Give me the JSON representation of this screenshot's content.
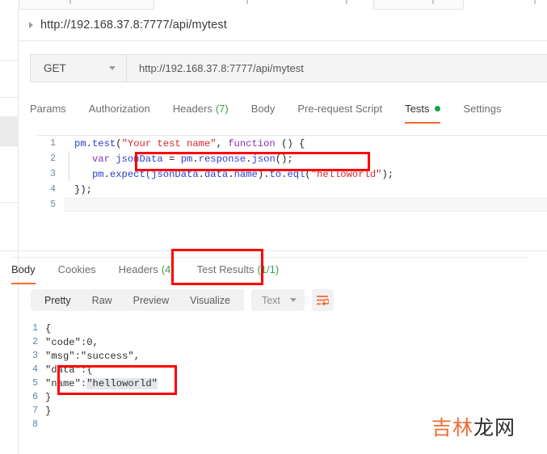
{
  "window": {
    "request_title": "http://192.168.37.8:7777/api/mytest",
    "collapse_icon": "caret-right-icon"
  },
  "url_bar": {
    "method": "GET",
    "method_dropdown_icon": "chevron-down-icon",
    "url": "http://192.168.37.8:7777/api/mytest"
  },
  "request_tabs": [
    {
      "label": "Params",
      "count": "",
      "active": false,
      "dot": false
    },
    {
      "label": "Authorization",
      "count": "",
      "active": false,
      "dot": false
    },
    {
      "label": "Headers",
      "count": "(7)",
      "active": false,
      "dot": false
    },
    {
      "label": "Body",
      "count": "",
      "active": false,
      "dot": false
    },
    {
      "label": "Pre-request Script",
      "count": "",
      "active": false,
      "dot": false
    },
    {
      "label": "Tests",
      "count": "",
      "active": true,
      "dot": true
    },
    {
      "label": "Settings",
      "count": "",
      "active": false,
      "dot": false
    }
  ],
  "script_editor": {
    "lines": [
      {
        "no": "1",
        "guide": false
      },
      {
        "no": "2",
        "guide": true
      },
      {
        "no": "3",
        "guide": true
      },
      {
        "no": "4",
        "guide": false
      },
      {
        "no": "5",
        "guide": false
      }
    ],
    "line1": {
      "a": "pm",
      "b": ".",
      "c": "test",
      "d": "(",
      "e": "\"Your test name\"",
      "f": ", ",
      "g": "function",
      "h": " () {"
    },
    "line2": {
      "a": "var",
      "b": " jsonData ",
      "c": "=",
      "d": " pm",
      "e": ".",
      "f": "response",
      "g": ".",
      "h": "json",
      "i": "();"
    },
    "line3": {
      "a": "pm",
      "b": ".",
      "c": "expect",
      "d": "(jsonData",
      "e": ".",
      "f": "data",
      "g": ".",
      "h": "name",
      "i": ").",
      "j": "to",
      "k": ".",
      "l": "eql",
      "m": "(",
      "n": "\"helloworld\"",
      "o": ");"
    },
    "line4": {
      "a": "});"
    }
  },
  "response_tabs": [
    {
      "label": "Body",
      "count": "",
      "active": true
    },
    {
      "label": "Cookies",
      "count": "",
      "active": false
    },
    {
      "label": "Headers",
      "count": "(4)",
      "active": false
    },
    {
      "label": "Test Results",
      "count": "(1/1)",
      "active": false
    }
  ],
  "format_bar": {
    "options": [
      "Pretty",
      "Raw",
      "Preview",
      "Visualize"
    ],
    "active_option": "Pretty",
    "type_label": "Text",
    "type_dropdown_icon": "chevron-down-icon",
    "wrap_icon": "word-wrap-icon"
  },
  "response_body": {
    "lines": [
      {
        "no": "1",
        "text": "{",
        "highlight": ""
      },
      {
        "no": "2",
        "text": "\"code\":0,",
        "highlight": ""
      },
      {
        "no": "3",
        "text": "\"msg\":\"success\",",
        "highlight": ""
      },
      {
        "no": "4",
        "text": "\"data\":{",
        "highlight": ""
      },
      {
        "no": "5",
        "text": "\"name\":",
        "highlight": "\"helloworld\""
      },
      {
        "no": "6",
        "text": "}",
        "highlight": ""
      },
      {
        "no": "7",
        "text": "}",
        "highlight": ""
      },
      {
        "no": "8",
        "text": "",
        "highlight": ""
      }
    ]
  },
  "annotations": {
    "box_script_assertion": "red-highlight-box",
    "box_test_results_tab": "red-highlight-box",
    "box_response_data": "red-highlight-box"
  },
  "watermark": {
    "orange_part": "吉林",
    "dark_part": "龙网"
  },
  "colors": {
    "accent_orange": "#ef6c33",
    "count_green": "#37a04a",
    "annotation_red": "#fe0000",
    "code_string": "#d6262b",
    "code_identifier": "#2b3dcf",
    "code_keyword": "#8a2fb5"
  }
}
